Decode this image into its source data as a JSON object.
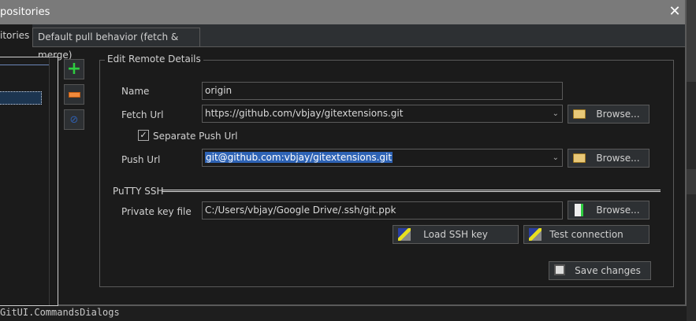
{
  "window": {
    "title": "positories",
    "close_icon": "close-icon"
  },
  "tabs": [
    {
      "label": "itories",
      "active": true
    },
    {
      "label": "Default pull behavior (fetch & merge)",
      "active": false
    }
  ],
  "group": {
    "title": "Edit Remote Details"
  },
  "fields": {
    "name": {
      "label": "Name",
      "value": "origin"
    },
    "fetch_url": {
      "label": "Fetch Url",
      "value": "https://github.com/vbjay/gitextensions.git"
    },
    "separate_push": {
      "label": "Separate Push Url",
      "checked": true
    },
    "push_url": {
      "label": "Push Url",
      "value": "git@github.com:vbjay/gitextensions.git"
    },
    "putty_section": "PuTTY SSH",
    "private_key": {
      "label": "Private key file",
      "value": "C:/Users/vbjay/Google Drive/.ssh/git.ppk"
    }
  },
  "buttons": {
    "browse": "Browse...",
    "load_ssh": "Load SSH key",
    "test_connection": "Test connection",
    "save": "Save changes"
  },
  "status_text": "GitUI.CommandsDialogs"
}
